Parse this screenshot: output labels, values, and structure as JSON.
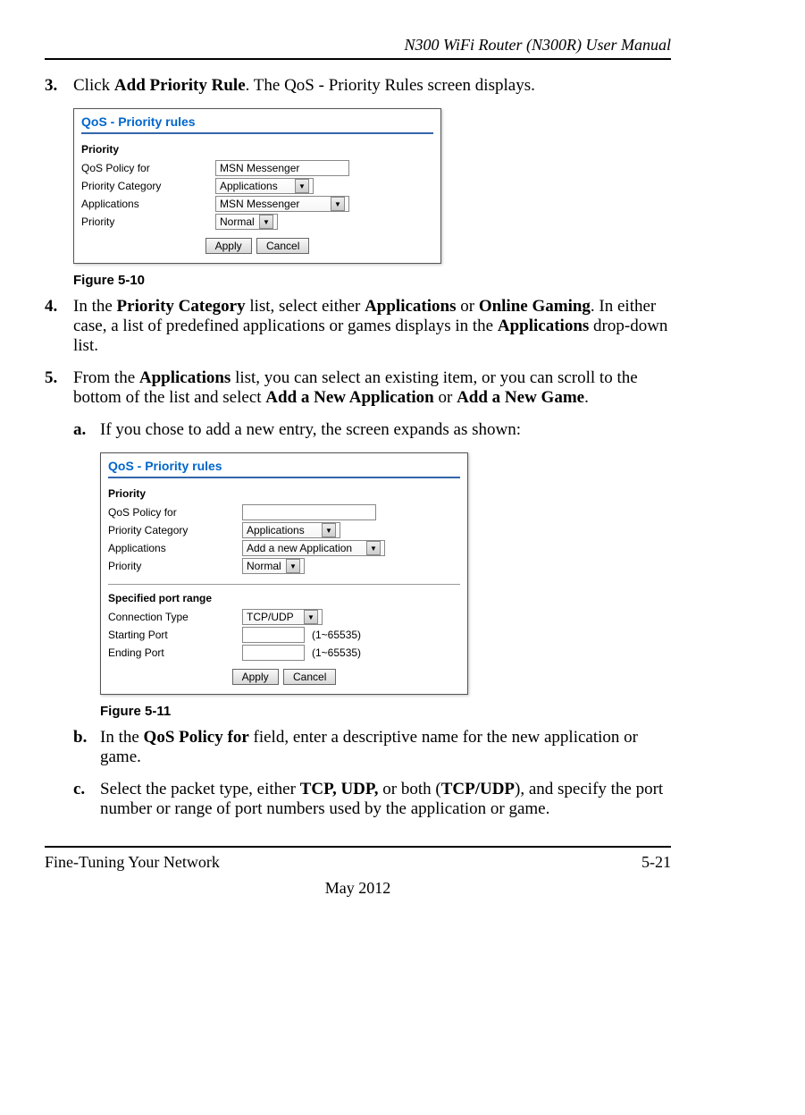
{
  "header": {
    "manual_title": "N300 WiFi Router (N300R) User Manual"
  },
  "steps": {
    "s3": {
      "num": "3.",
      "pre": "Click ",
      "link": "Add Priority Rule",
      "post": ". The QoS - Priority Rules screen displays."
    },
    "s4": {
      "num": "4.",
      "t1": "In the ",
      "b1": "Priority Category",
      "t2": " list, select either ",
      "b2": "Applications",
      "t3": " or ",
      "b3": "Online Gaming",
      "t4": ". In either case, a list of predefined applications or games displays in the ",
      "b4": "Applications",
      "t5": " drop-down list."
    },
    "s5": {
      "num": "5.",
      "t1": "From the ",
      "b1": "Applications",
      "t2": " list, you can select an existing item, or you can scroll to the bottom of the list and select ",
      "b2": "Add a New Application",
      "t3": " or ",
      "b3": "Add a New Game",
      "t4": "."
    },
    "sa": {
      "num": "a.",
      "text": "If you chose to add a new entry, the screen expands as shown:"
    },
    "sb": {
      "num": "b.",
      "t1": "In the ",
      "b1": "QoS Policy for",
      "t2": " field, enter a descriptive name for the new application or game."
    },
    "sc": {
      "num": "c.",
      "t1": "Select the packet type, either ",
      "b1": "TCP, UDP,",
      "t2": " or both (",
      "b2": "TCP/UDP",
      "t3": "), and specify the port number or range of port numbers used by the application or game."
    }
  },
  "fig1": {
    "caption": "Figure 5-10",
    "title": "QoS - Priority rules",
    "section": "Priority",
    "rows": {
      "policy_label": "QoS Policy for",
      "policy_value": "MSN Messenger",
      "category_label": "Priority Category",
      "category_value": "Applications",
      "apps_label": "Applications",
      "apps_value": "MSN Messenger",
      "priority_label": "Priority",
      "priority_value": "Normal"
    },
    "buttons": {
      "apply": "Apply",
      "cancel": "Cancel"
    }
  },
  "fig2": {
    "caption": "Figure 5-11",
    "title": "QoS - Priority rules",
    "section1": "Priority",
    "rows1": {
      "policy_label": "QoS Policy for",
      "policy_value": "",
      "category_label": "Priority Category",
      "category_value": "Applications",
      "apps_label": "Applications",
      "apps_value": "Add a new Application",
      "priority_label": "Priority",
      "priority_value": "Normal"
    },
    "section2": "Specified port range",
    "rows2": {
      "conn_label": "Connection Type",
      "conn_value": "TCP/UDP",
      "start_label": "Starting Port",
      "start_hint": "(1~65535)",
      "end_label": "Ending Port",
      "end_hint": "(1~65535)"
    },
    "buttons": {
      "apply": "Apply",
      "cancel": "Cancel"
    }
  },
  "footer": {
    "left": "Fine-Tuning Your Network",
    "right": "5-21",
    "date": "May 2012"
  }
}
